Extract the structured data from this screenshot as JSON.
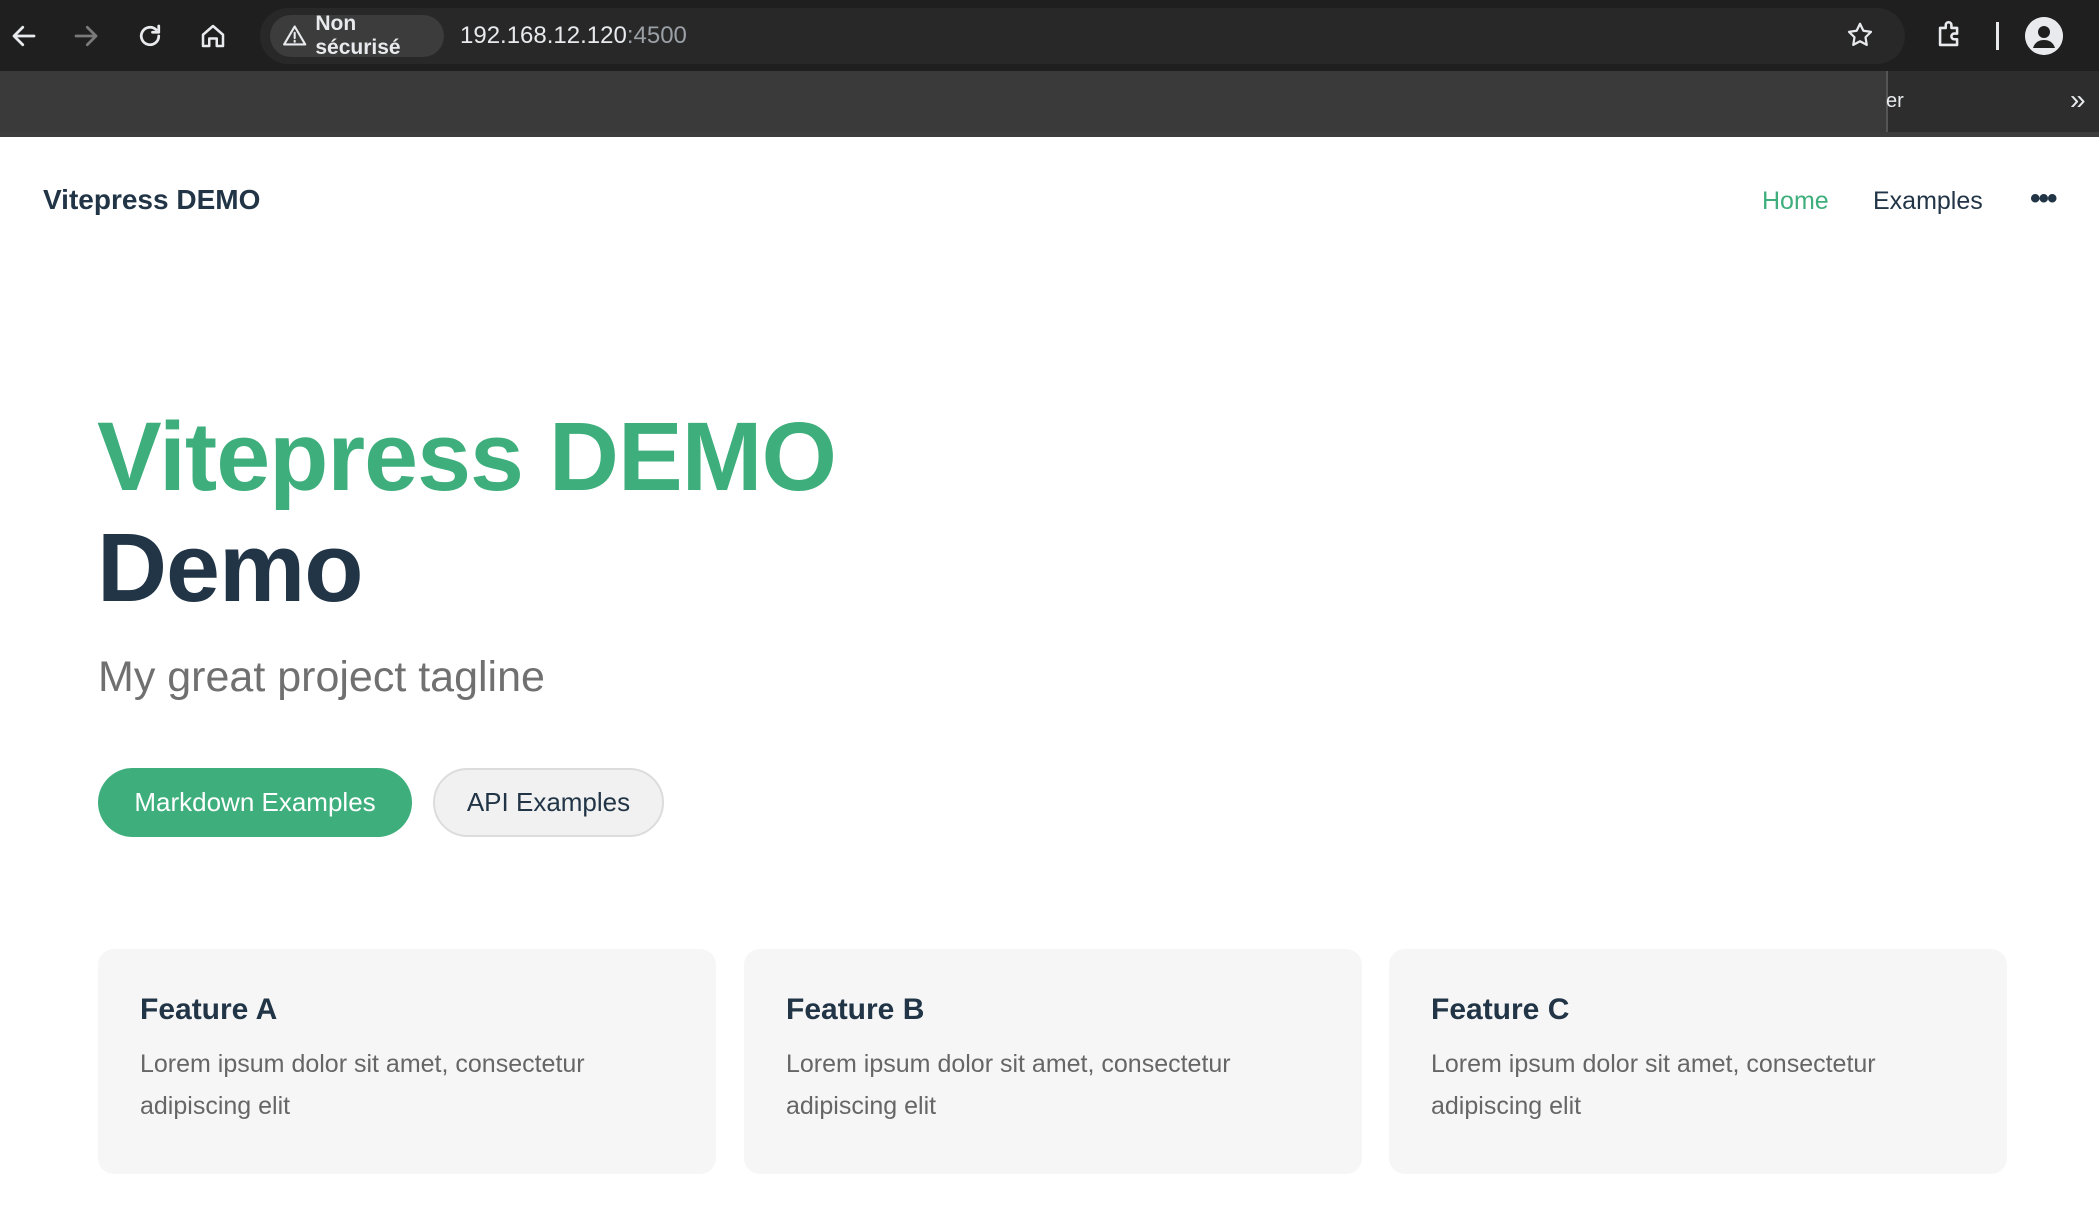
{
  "browser": {
    "security_label": "Non sécurisé",
    "url_host": "192.168.12.120",
    "url_port": ":4500",
    "bookmark_fragment": "er",
    "bookmark_more": "»"
  },
  "navbar": {
    "title": "Vitepress DEMO",
    "items": [
      {
        "label": "Home",
        "active": true
      },
      {
        "label": "Examples",
        "active": false
      }
    ],
    "more_label": "•••"
  },
  "hero": {
    "name": "Vitepress DEMO",
    "text": "Demo",
    "tagline": "My great project tagline",
    "actions": [
      {
        "label": "Markdown Examples",
        "theme": "brand"
      },
      {
        "label": "API Examples",
        "theme": "alt"
      }
    ]
  },
  "features": [
    {
      "title": "Feature A",
      "details": "Lorem ipsum dolor sit amet, consectetur adipiscing elit"
    },
    {
      "title": "Feature B",
      "details": "Lorem ipsum dolor sit amet, consectetur adipiscing elit"
    },
    {
      "title": "Feature C",
      "details": "Lorem ipsum dolor sit amet, consectetur adipiscing elit"
    }
  ],
  "colors": {
    "brand": "#3eaf7c",
    "text": "#213547",
    "chrome_dark": "#1f1f1f"
  }
}
